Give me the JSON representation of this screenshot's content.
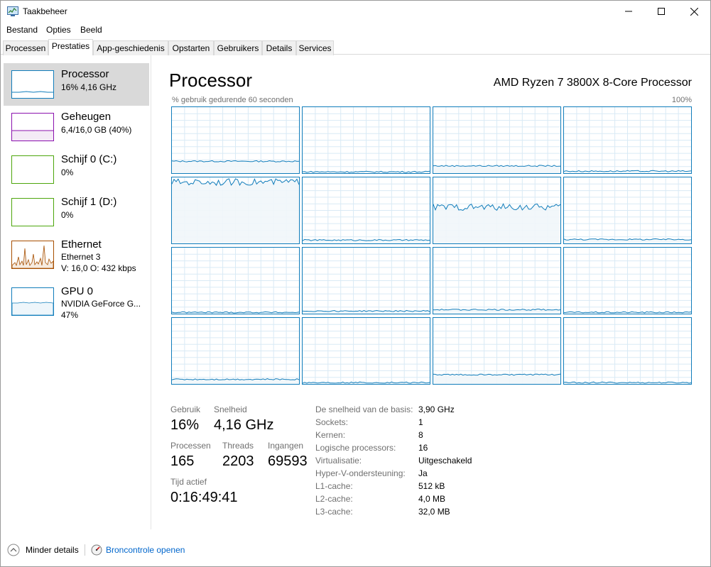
{
  "window": {
    "title": "Taakbeheer"
  },
  "menu": [
    "Bestand",
    "Opties",
    "Beeld"
  ],
  "tabs": [
    "Processen",
    "Prestaties",
    "App-geschiedenis",
    "Opstarten",
    "Gebruikers",
    "Details",
    "Services"
  ],
  "active_tab": "Prestaties",
  "sidebar": [
    {
      "name": "Processor",
      "line1": "16% 4,16 GHz",
      "line2": "",
      "color": "#117dbb"
    },
    {
      "name": "Geheugen",
      "line1": "6,4/16,0 GB (40%)",
      "line2": "",
      "color": "#8b12ae"
    },
    {
      "name": "Schijf 0 (C:)",
      "line1": "0%",
      "line2": "",
      "color": "#4da60c"
    },
    {
      "name": "Schijf 1 (D:)",
      "line1": "0%",
      "line2": "",
      "color": "#4da60c"
    },
    {
      "name": "Ethernet",
      "line1": "Ethernet 3",
      "line2": "V: 16,0  O: 432 kbps",
      "color": "#a74f01"
    },
    {
      "name": "GPU 0",
      "line1": "NVIDIA GeForce G...",
      "line2": "47%",
      "color": "#117dbb"
    }
  ],
  "main": {
    "title": "Processor",
    "model": "AMD Ryzen 7 3800X 8-Core Processor",
    "graph_label": "% gebruik gedurende 60 seconden",
    "graph_max": "100%",
    "core_levels": [
      0.18,
      0.02,
      0.11,
      0.03,
      0.93,
      0.05,
      0.55,
      0.06,
      0.02,
      0.04,
      0.06,
      0.02,
      0.07,
      0.02,
      0.14,
      0.02
    ]
  },
  "stats": {
    "gebruik_label": "Gebruik",
    "gebruik": "16%",
    "snelheid_label": "Snelheid",
    "snelheid": "4,16 GHz",
    "processen_label": "Processen",
    "processen": "165",
    "threads_label": "Threads",
    "threads": "2203",
    "ingangen_label": "Ingangen",
    "ingangen": "69593",
    "tijd_label": "Tijd actief",
    "tijd": "0:16:49:41"
  },
  "details": [
    {
      "label": "De snelheid van de basis:",
      "value": "3,90 GHz"
    },
    {
      "label": "Sockets:",
      "value": "1"
    },
    {
      "label": "Kernen:",
      "value": "8"
    },
    {
      "label": "Logische processors:",
      "value": "16"
    },
    {
      "label": "Virtualisatie:",
      "value": "Uitgeschakeld"
    },
    {
      "label": "Hyper-V-ondersteuning:",
      "value": "Ja"
    },
    {
      "label": "L1-cache:",
      "value": "512 kB"
    },
    {
      "label": "L2-cache:",
      "value": "4,0 MB"
    },
    {
      "label": "L3-cache:",
      "value": "32,0 MB"
    }
  ],
  "footer": {
    "less": "Minder details",
    "monitor": "Broncontrole openen"
  },
  "colors": {
    "accent": "#117dbb",
    "link": "#0066cc"
  }
}
